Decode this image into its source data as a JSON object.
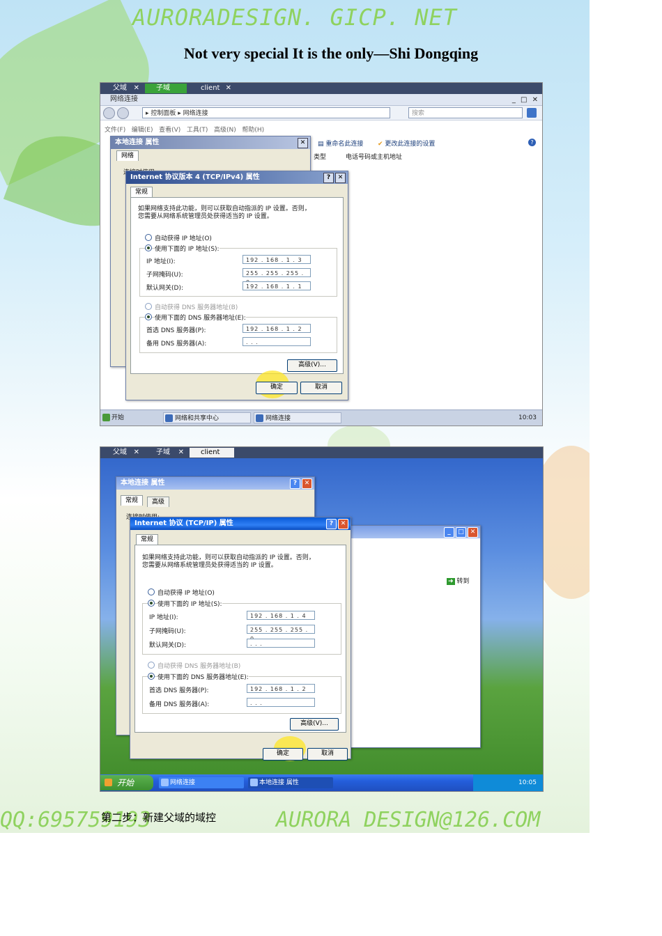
{
  "header": {
    "site": "AURORADESIGN. GICP. NET",
    "subtitle": "Not very special It is the only—Shi Dongqing"
  },
  "shot1": {
    "tabs": [
      "父域",
      "子域",
      "client"
    ],
    "window_title": "网络连接",
    "breadcrumb": "▸ 控制面板 ▸ 网络连接",
    "search_placeholder": "搜索",
    "menu": [
      "文件(F)",
      "编辑(E)",
      "查看(V)",
      "工具(T)",
      "高级(N)",
      "帮助(H)"
    ],
    "toolbar": [
      "重命名此连接",
      "更改此连接的设置"
    ],
    "columns": [
      "类型",
      "电话号码或主机地址"
    ],
    "props_title": "本地连接 属性",
    "props_tab": "网络",
    "props_text": "连接时使用:",
    "dialog": {
      "title": "Internet 协议版本 4 (TCP/IPv4) 属性",
      "tab": "常规",
      "desc1": "如果网络支持此功能，则可以获取自动指派的 IP 设置。否则，",
      "desc2": "您需要从网络系统管理员处获得适当的 IP 设置。",
      "auto_ip": "自动获得 IP 地址(O)",
      "manual_ip": "使用下面的 IP 地址(S):",
      "ip_label": "IP 地址(I):",
      "ip": "192 . 168 .  1  .  3",
      "mask_label": "子网掩码(U):",
      "mask": "255 . 255 . 255 .  0",
      "gw_label": "默认网关(D):",
      "gw": "192 . 168 .  1  .  1",
      "auto_dns": "自动获得 DNS 服务器地址(B)",
      "manual_dns": "使用下面的 DNS 服务器地址(E):",
      "dns1_label": "首选 DNS 服务器(P):",
      "dns1": "192 . 168 .  1  .  2",
      "dns2_label": "备用 DNS 服务器(A):",
      "dns2": "  .     .     .  ",
      "advanced": "高级(V)...",
      "ok": "确定",
      "cancel": "取消"
    },
    "taskbar": {
      "start": "开始",
      "items": [
        "网络和共享中心",
        "网络连接"
      ],
      "clock": "10:03"
    }
  },
  "shot2": {
    "tabs": [
      "父域",
      "子域",
      "client"
    ],
    "props_title": "本地连接 属性",
    "props_tabs": [
      "常规",
      "高级"
    ],
    "props_text": "连接时使用:",
    "bg_toolbar": "转到",
    "dialog": {
      "title": "Internet 协议 (TCP/IP) 属性",
      "tab": "常规",
      "desc1": "如果网络支持此功能，则可以获取自动指派的 IP 设置。否则，",
      "desc2": "您需要从网络系统管理员处获得适当的 IP 设置。",
      "auto_ip": "自动获得 IP 地址(O)",
      "manual_ip": "使用下面的 IP 地址(S):",
      "ip_label": "IP 地址(I):",
      "ip": "192 . 168 .  1  .  4",
      "mask_label": "子网掩码(U):",
      "mask": "255 . 255 . 255 .  0",
      "gw_label": "默认网关(D):",
      "gw": "  .     .     .  ",
      "auto_dns": "自动获得 DNS 服务器地址(B)",
      "manual_dns": "使用下面的 DNS 服务器地址(E):",
      "dns1_label": "首选 DNS 服务器(P):",
      "dns1": "192 . 168 .  1  .  2",
      "dns2_label": "备用 DNS 服务器(A):",
      "dns2": "  .     .     .  ",
      "advanced": "高级(V)...",
      "ok": "确定",
      "cancel": "取消"
    },
    "taskbar": {
      "start": "开始",
      "items": [
        "网络连接",
        "本地连接 属性"
      ],
      "clock": "10:05"
    }
  },
  "footer": {
    "qq": "QQ:695759193",
    "mail": "AURORA DESIGN@126.COM",
    "step": "第二步：新建父域的域控"
  },
  "colors": {
    "accent_green": "#8fd25f",
    "xp_blue": "#245edb",
    "taskbar_server": "#c9d3e4"
  }
}
